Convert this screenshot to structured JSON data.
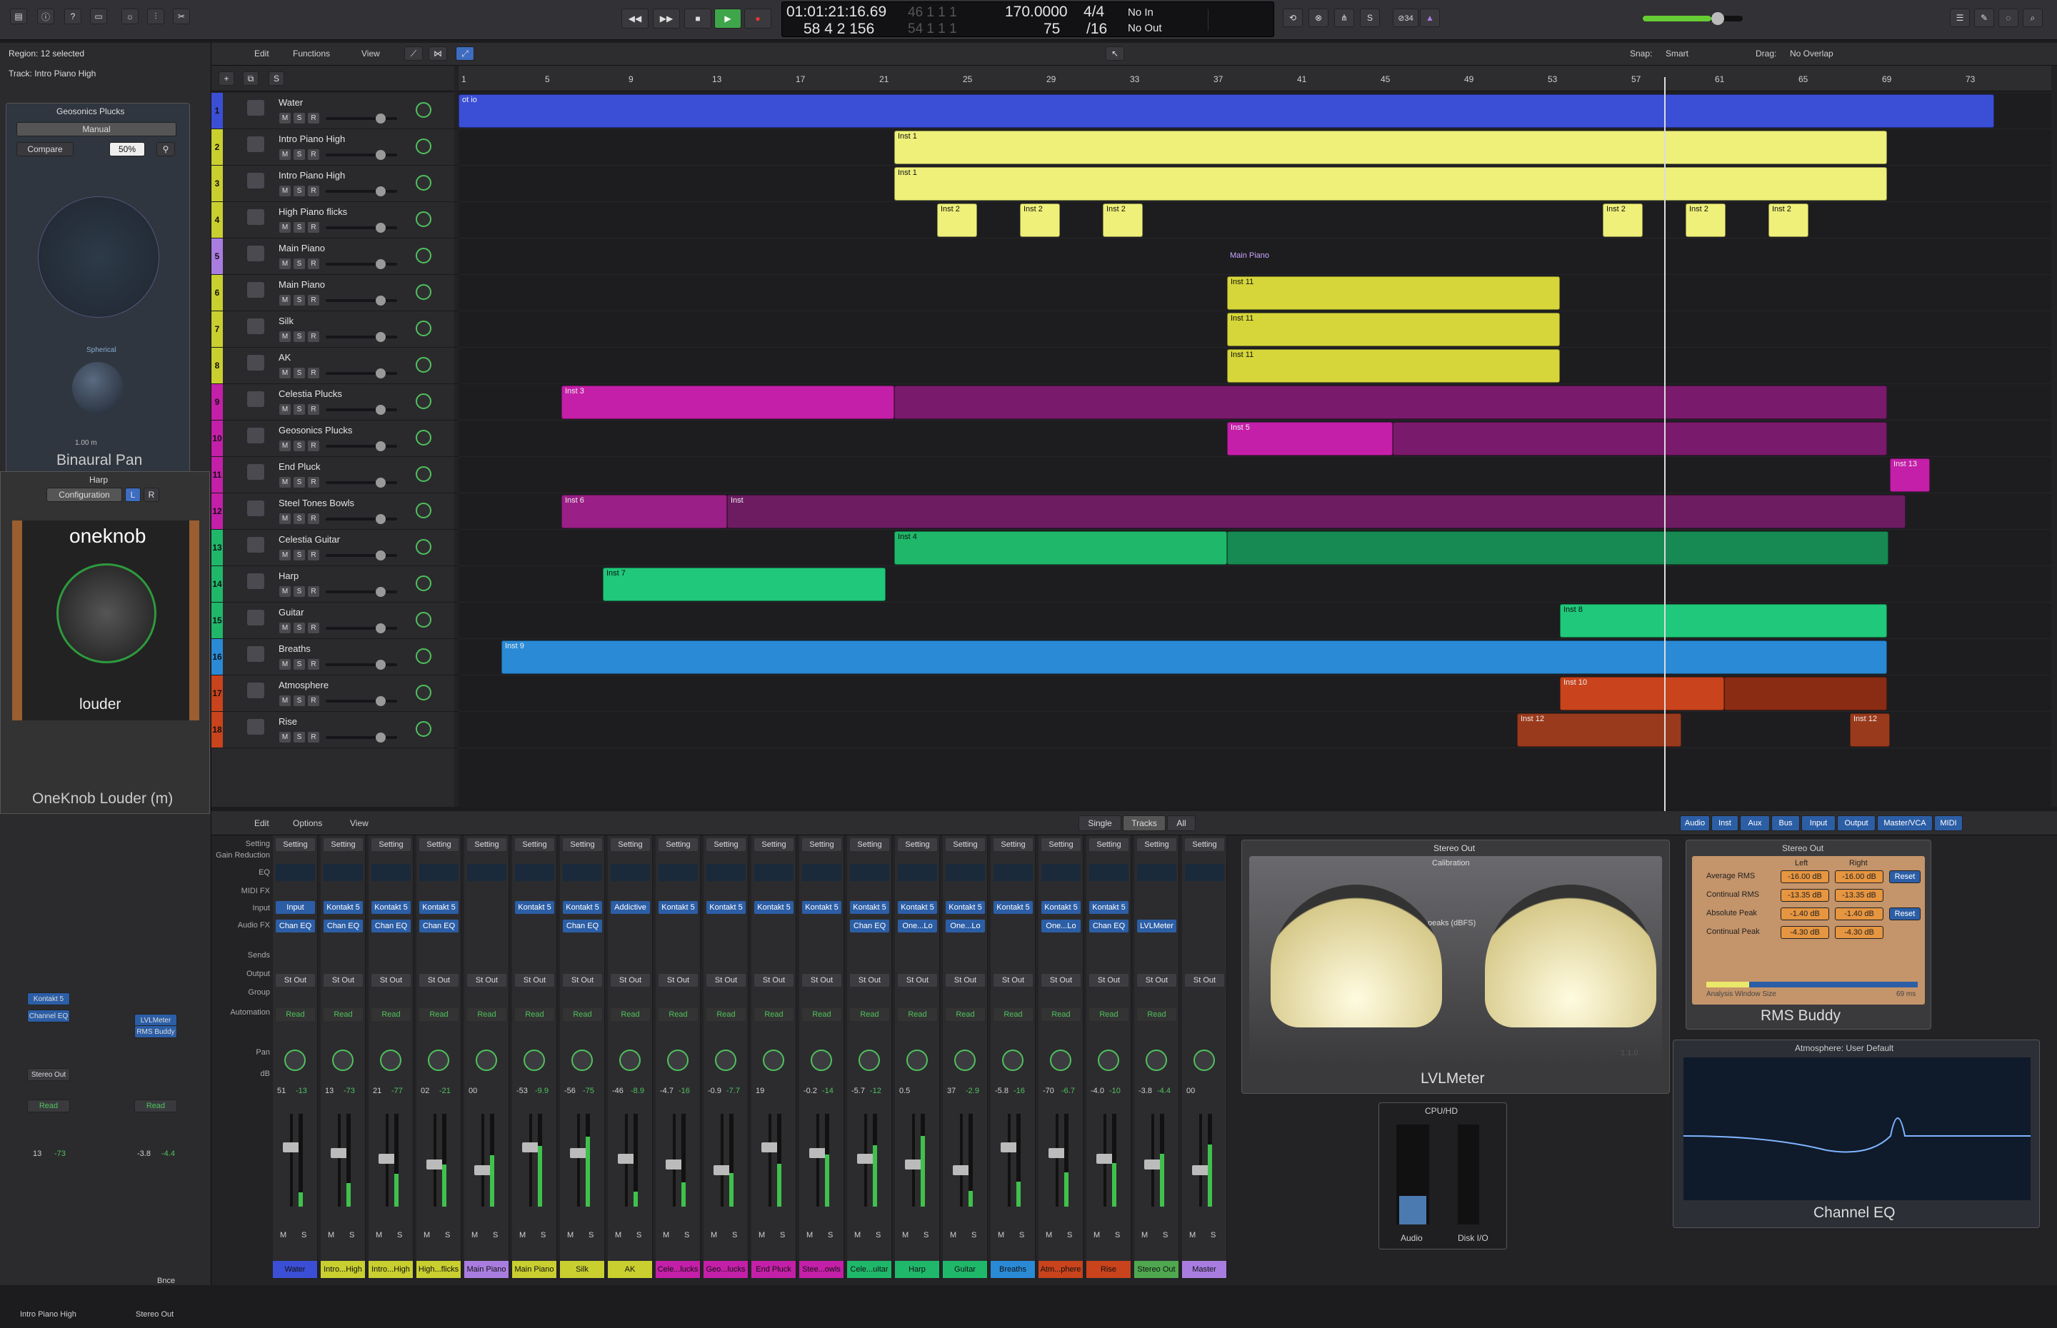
{
  "toolbar": {
    "time": "01:01:21:16.69",
    "bars": "58 4 2 156",
    "ghost1": "46 1 1 1",
    "ghost2": "54 1 1 1",
    "tempo": "170.0000",
    "tempo_sub": "75",
    "sig": "4/4",
    "div": "/16",
    "in": "No In",
    "out": "No Out",
    "badge": "⊘34"
  },
  "inspector": {
    "region": "Region: 12 selected",
    "track": "Track: Intro Piano High",
    "plugin1": {
      "title": "Geosonics Plucks",
      "mode": "Manual",
      "compare": "Compare",
      "pct": "50%",
      "footer": "Binaural Pan",
      "spherical": "Spherical",
      "size": "1.00 m"
    },
    "plugin2": {
      "title": "Harp",
      "config": "Configuration",
      "l": "L",
      "r": "R",
      "brand": "oneknob",
      "sub": "louder",
      "footer": "OneKnob Louder (m)"
    }
  },
  "arrange": {
    "menu": [
      "Edit",
      "Functions",
      "View"
    ],
    "snap_label": "Snap:",
    "snap": "Smart",
    "drag_label": "Drag:",
    "drag": "No Overlap",
    "ruler": [
      "1",
      "5",
      "9",
      "13",
      "17",
      "21",
      "25",
      "29",
      "33",
      "37",
      "41",
      "45",
      "49",
      "53",
      "57",
      "61",
      "65",
      "69",
      "73"
    ],
    "tracks": [
      {
        "n": "1",
        "name": "Water",
        "color": "#3b4fd6"
      },
      {
        "n": "2",
        "name": "Intro Piano High",
        "color": "#c9cf2f"
      },
      {
        "n": "3",
        "name": "Intro Piano High",
        "color": "#c9cf2f"
      },
      {
        "n": "4",
        "name": "High Piano flicks",
        "color": "#c9cf2f"
      },
      {
        "n": "5",
        "name": "Main Piano",
        "color": "#a97de0"
      },
      {
        "n": "6",
        "name": "Main Piano",
        "color": "#c9cf2f"
      },
      {
        "n": "7",
        "name": "Silk",
        "color": "#c9cf2f"
      },
      {
        "n": "8",
        "name": "AK",
        "color": "#c9cf2f"
      },
      {
        "n": "9",
        "name": "Celestia Plucks",
        "color": "#c41fa8"
      },
      {
        "n": "10",
        "name": "Geosonics Plucks",
        "color": "#c41fa8"
      },
      {
        "n": "11",
        "name": "End Pluck",
        "color": "#c41fa8"
      },
      {
        "n": "12",
        "name": "Steel Tones Bowls",
        "color": "#c41fa8"
      },
      {
        "n": "13",
        "name": "Celestia Guitar",
        "color": "#1fb86a"
      },
      {
        "n": "14",
        "name": "Harp",
        "color": "#1fb86a"
      },
      {
        "n": "15",
        "name": "Guitar",
        "color": "#1fb86a"
      },
      {
        "n": "16",
        "name": "Breaths",
        "color": "#2a8ad6"
      },
      {
        "n": "17",
        "name": "Atmosphere",
        "color": "#c9431c"
      },
      {
        "n": "18",
        "name": "Rise",
        "color": "#c9431c"
      }
    ],
    "folder_label": "Main Piano",
    "region_names": [
      "Inst 1",
      "Inst 2",
      "Inst 11",
      "Inst 3",
      "Inst 5",
      "Inst 13",
      "Inst 6",
      "Inst",
      "Inst 4",
      "Inst 7",
      "Inst 8",
      "Inst 9",
      "Inst 10",
      "Inst 12",
      "ot io"
    ]
  },
  "mixer": {
    "menu": [
      "Edit",
      "Options",
      "View"
    ],
    "modes": [
      "Single",
      "Tracks",
      "All"
    ],
    "filters": [
      "Audio",
      "Inst",
      "Aux",
      "Bus",
      "Input",
      "Output",
      "Master/VCA",
      "MIDI"
    ],
    "row_labels": [
      "Setting",
      "Gain Reduction",
      "EQ",
      "MIDI FX",
      "Input",
      "Audio FX",
      "Sends",
      "Output",
      "Group",
      "Automation",
      "",
      "Pan",
      "dB"
    ],
    "strips": [
      {
        "name": "Water",
        "color": "#3b4fd6",
        "input": "Input",
        "fx": "Chan EQ",
        "db": "51",
        "db2": "-13",
        "auto": "Read"
      },
      {
        "name": "Intro...High",
        "color": "#c9cf2f",
        "input": "Kontakt 5",
        "fx": "Chan EQ",
        "db": "13",
        "db2": "-73",
        "auto": "Read"
      },
      {
        "name": "Intro...High",
        "color": "#c9cf2f",
        "input": "Kontakt 5",
        "fx": "Chan EQ",
        "db": "21",
        "db2": "-77",
        "auto": "Read"
      },
      {
        "name": "High...flicks",
        "color": "#c9cf2f",
        "input": "Kontakt 5",
        "fx": "Chan EQ",
        "db": "02",
        "db2": "-21",
        "auto": "Read"
      },
      {
        "name": "Main Piano",
        "color": "#a97de0",
        "input": "",
        "fx": "",
        "db": "00",
        "db2": "",
        "auto": "Read"
      },
      {
        "name": "Main Piano",
        "color": "#c9cf2f",
        "input": "Kontakt 5",
        "fx": "",
        "db": "-53",
        "db2": "-9.9",
        "auto": "Read"
      },
      {
        "name": "Silk",
        "color": "#c9cf2f",
        "input": "Kontakt 5",
        "fx": "Chan EQ",
        "db": "-56",
        "db2": "-75",
        "auto": "Read"
      },
      {
        "name": "AK",
        "color": "#c9cf2f",
        "input": "Addictive",
        "fx": "",
        "db": "-46",
        "db2": "-8.9",
        "auto": "Read"
      },
      {
        "name": "Cele...lucks",
        "color": "#c41fa8",
        "input": "Kontakt 5",
        "fx": "",
        "db": "-4.7",
        "db2": "-16",
        "auto": "Read"
      },
      {
        "name": "Geo...lucks",
        "color": "#c41fa8",
        "input": "Kontakt 5",
        "fx": "",
        "db": "-0.9",
        "db2": "-7.7",
        "auto": "Read"
      },
      {
        "name": "End Pluck",
        "color": "#c41fa8",
        "input": "Kontakt 5",
        "fx": "",
        "db": "19",
        "db2": "",
        "auto": "Read"
      },
      {
        "name": "Stee...owls",
        "color": "#c41fa8",
        "input": "Kontakt 5",
        "fx": "",
        "db": "-0.2",
        "db2": "-14",
        "auto": "Read"
      },
      {
        "name": "Cele...uitar",
        "color": "#1fb86a",
        "input": "Kontakt 5",
        "fx": "Chan EQ",
        "db": "-5.7",
        "db2": "-12",
        "auto": "Read"
      },
      {
        "name": "Harp",
        "color": "#1fb86a",
        "input": "Kontakt 5",
        "fx": "One...Lo",
        "db": "0.5",
        "db2": "",
        "auto": "Read"
      },
      {
        "name": "Guitar",
        "color": "#1fb86a",
        "input": "Kontakt 5",
        "fx": "One...Lo",
        "db": "37",
        "db2": "-2.9",
        "auto": "Read"
      },
      {
        "name": "Breaths",
        "color": "#2a8ad6",
        "input": "Kontakt 5",
        "fx": "",
        "db": "-5.8",
        "db2": "-16",
        "auto": "Read"
      },
      {
        "name": "Atm...phere",
        "color": "#c9431c",
        "input": "Kontakt 5",
        "fx": "One...Lo",
        "db": "-70",
        "db2": "-6.7",
        "auto": "Read"
      },
      {
        "name": "Rise",
        "color": "#c9431c",
        "input": "Kontakt 5",
        "fx": "Chan EQ",
        "db": "-4.0",
        "db2": "-10",
        "auto": "Read"
      },
      {
        "name": "Stereo Out",
        "color": "#4fa84f",
        "input": "",
        "fx": "LVLMeter",
        "db": "-3.8",
        "db2": "-4.4",
        "auto": "Read"
      },
      {
        "name": "Master",
        "color": "#a97de0",
        "input": "",
        "fx": "",
        "db": "00",
        "db2": "",
        "auto": ""
      }
    ]
  },
  "left_strips": {
    "a": {
      "name": "Intro Piano High",
      "input": "Kontakt 5",
      "fx": "Channel EQ",
      "out": "Stereo Out",
      "auto": "Read",
      "db": "13",
      "db2": "-73"
    },
    "b": {
      "name": "Stereo Out",
      "fx1": "LVLMeter",
      "fx2": "RMS Buddy",
      "auto": "Read",
      "db": "-3.8",
      "db2": "-4.4",
      "bnc": "Bnce"
    }
  },
  "plugins": {
    "lvl": {
      "title": "Stereo Out",
      "sub": "Calibration",
      "peaks": "peaks (dBFS)",
      "footer": "LVLMeter",
      "ver": "1.1.0"
    },
    "cpu": {
      "title": "CPU/HD",
      "audio": "Audio",
      "disk": "Disk I/O"
    },
    "rms": {
      "title": "Stereo Out",
      "left": "Left",
      "right": "Right",
      "rows": [
        {
          "l": "Average RMS",
          "a": "-16.00 dB",
          "b": "-16.00 dB",
          "btn": "Reset"
        },
        {
          "l": "Continual RMS",
          "a": "-13.35 dB",
          "b": "-13.35 dB",
          "btn": ""
        },
        {
          "l": "Absolute Peak",
          "a": "-1.40 dB",
          "b": "-1.40 dB",
          "btn": "Reset"
        },
        {
          "l": "Continual Peak",
          "a": "-4.30 dB",
          "b": "-4.30 dB",
          "btn": ""
        }
      ],
      "window": "Analysis Window Size",
      "ms": "69 ms",
      "footer": "RMS Buddy"
    },
    "eq": {
      "title": "Atmosphere: User Default",
      "footer": "Channel EQ"
    }
  }
}
